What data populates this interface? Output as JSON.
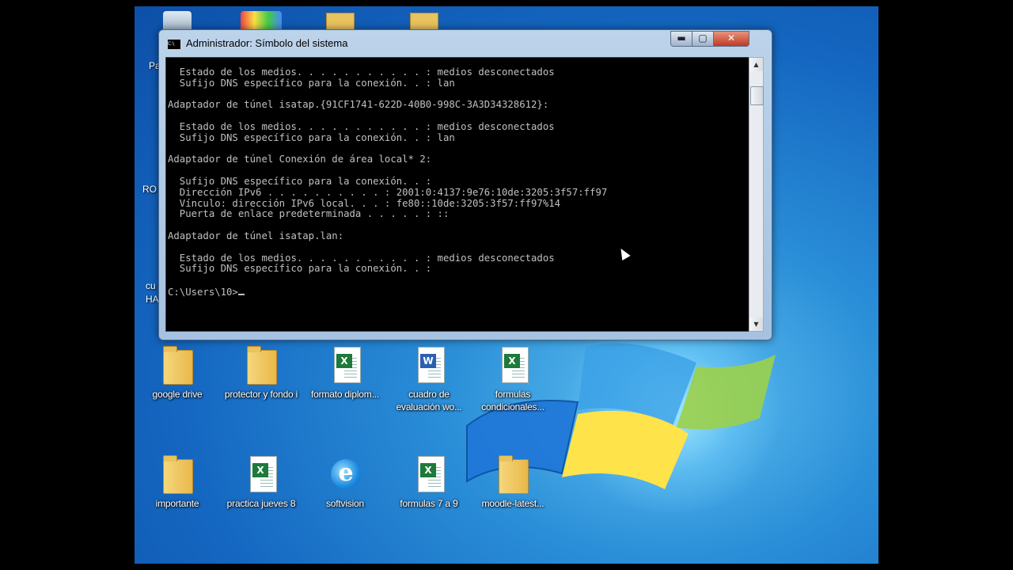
{
  "window": {
    "title": "Administrador: Símbolo del sistema",
    "title_icon": "C:\\",
    "buttons": {
      "minimize": "▬",
      "maximize": "▢",
      "close": "✕"
    },
    "console_lines": [
      "  Estado de los medios. . . . . . . . . . . : medios desconectados",
      "  Sufijo DNS específico para la conexión. . : lan",
      "",
      "Adaptador de túnel isatap.{91CF1741-622D-40B0-998C-3A3D34328612}:",
      "",
      "  Estado de los medios. . . . . . . . . . . : medios desconectados",
      "  Sufijo DNS específico para la conexión. . : lan",
      "",
      "Adaptador de túnel Conexión de área local* 2:",
      "",
      "  Sufijo DNS específico para la conexión. . :",
      "  Dirección IPv6 . . . . . . . . . . : 2001:0:4137:9e76:10de:3205:3f57:ff97",
      "  Vínculo: dirección IPv6 local. . . : fe80::10de:3205:3f57:ff97%14",
      "  Puerta de enlace predeterminada . . . . . : ::",
      "",
      "Adaptador de túnel isatap.lan:",
      "",
      "  Estado de los medios. . . . . . . . . . . : medios desconectados",
      "  Sufijo DNS específico para la conexión. . :",
      ""
    ],
    "prompt": "C:\\Users\\10>",
    "scroll_up": "▲",
    "scroll_down": "▼"
  },
  "desktop": {
    "side_labels": [
      "Pa",
      "RO",
      "cu",
      "HA"
    ],
    "icons_row1": [
      {
        "label": "google drive",
        "type": "folder-icon"
      },
      {
        "label": "protector y fondo i",
        "type": "folder-icon"
      },
      {
        "label": "formato diplom...",
        "type": "excel-icon"
      },
      {
        "label": "cuadro de evaluación wo...",
        "type": "word-icon"
      },
      {
        "label": "formulas condicionales...",
        "type": "excel-icon"
      }
    ],
    "icons_row2": [
      {
        "label": "importante",
        "type": "folder-icon"
      },
      {
        "label": "practica jueves 8",
        "type": "excel-icon"
      },
      {
        "label": "softvision",
        "type": "ie-icon"
      },
      {
        "label": "formulas 7 a 9",
        "type": "excel-icon"
      },
      {
        "label": "moodle-latest...",
        "type": "folder-icon"
      }
    ]
  }
}
